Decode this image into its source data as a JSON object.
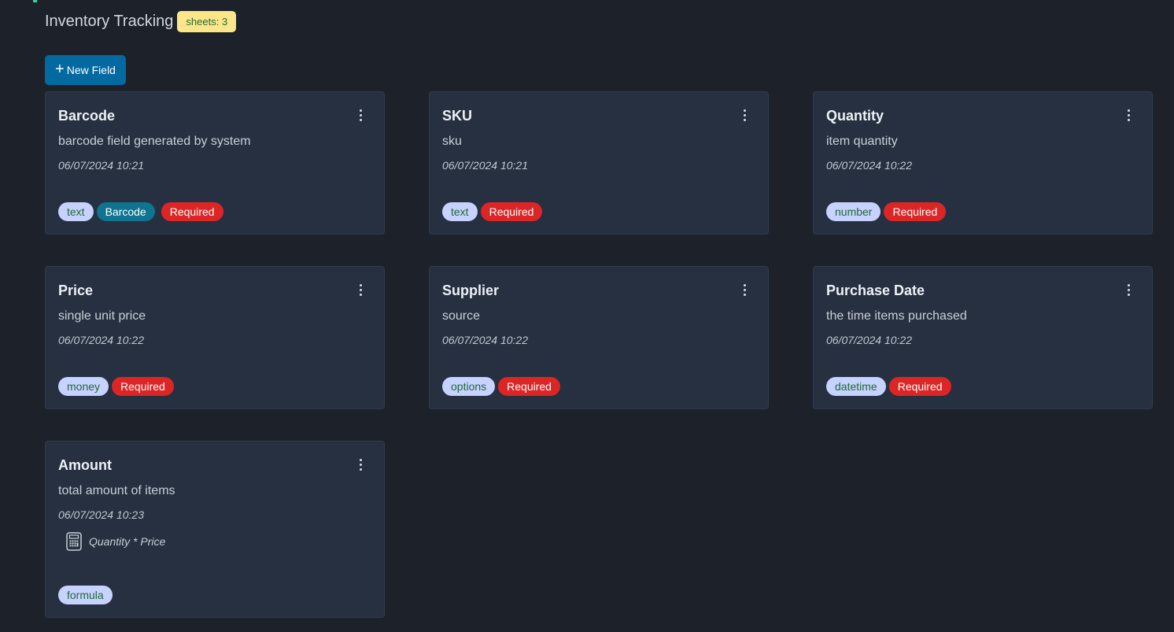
{
  "header": {
    "title": "Inventory Tracking",
    "badge": "sheets: 3"
  },
  "toolbar": {
    "new_field_label": "New Field",
    "new_field_icon": "plus-icon"
  },
  "fields": [
    {
      "title": "Barcode",
      "description": "barcode field generated by system",
      "date": "06/07/2024 10:21",
      "type": "text",
      "extra_tag": "Barcode",
      "required": "Required"
    },
    {
      "title": "SKU",
      "description": "sku",
      "date": "06/07/2024 10:21",
      "type": "text",
      "required": "Required"
    },
    {
      "title": "Quantity",
      "description": "item quantity",
      "date": "06/07/2024 10:22",
      "type": "number",
      "required": "Required"
    },
    {
      "title": "Price",
      "description": "single unit price",
      "date": "06/07/2024 10:22",
      "type": "money",
      "required": "Required"
    },
    {
      "title": "Supplier",
      "description": "source",
      "date": "06/07/2024 10:22",
      "type": "options",
      "required": "Required"
    },
    {
      "title": "Purchase Date",
      "description": "the time items purchased",
      "date": "06/07/2024 10:22",
      "type": "datetime",
      "required": "Required"
    },
    {
      "title": "Amount",
      "description": "total amount of items",
      "date": "06/07/2024 10:23",
      "type": "formula",
      "formula": "Quantity * Price",
      "formula_icon": "calculator-icon"
    }
  ],
  "colors": {
    "primary": "#0369a1",
    "required": "#dc2626",
    "barcode": "#0e7490",
    "type_tag": "#c7d2fe",
    "badge": "#fde68a"
  }
}
